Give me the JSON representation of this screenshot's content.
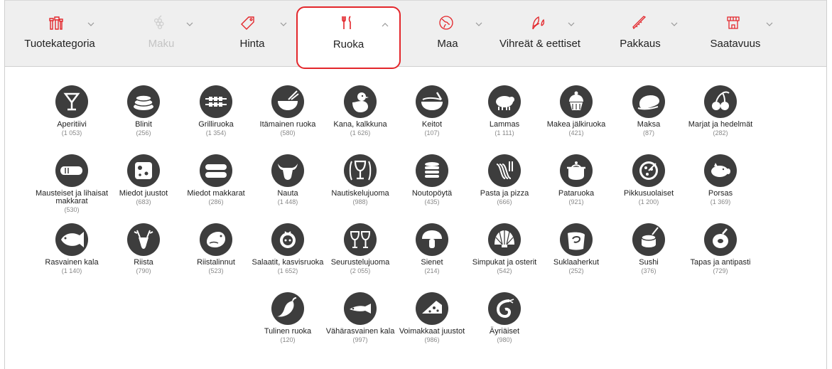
{
  "filter_tabs": [
    {
      "id": "tuotekategoria",
      "label": "Tuotekategoria",
      "icon": "bottles-icon",
      "state": "normal",
      "chevron": "down"
    },
    {
      "id": "maku",
      "label": "Maku",
      "icon": "grapes-icon",
      "state": "disabled",
      "chevron": "down"
    },
    {
      "id": "hinta",
      "label": "Hinta",
      "icon": "price-tag-icon",
      "state": "normal",
      "chevron": "down"
    },
    {
      "id": "ruoka",
      "label": "Ruoka",
      "icon": "fork-knife-icon",
      "state": "active",
      "chevron": "up"
    },
    {
      "id": "maa",
      "label": "Maa",
      "icon": "globe-icon",
      "state": "normal",
      "chevron": "down"
    },
    {
      "id": "vihreat",
      "label": "Vihreät & eettiset",
      "icon": "leaf-icon",
      "state": "normal",
      "chevron": "down"
    },
    {
      "id": "pakkaus",
      "label": "Pakkaus",
      "icon": "package-icon",
      "state": "normal",
      "chevron": "down"
    },
    {
      "id": "saatavuus",
      "label": "Saatavuus",
      "icon": "store-icon",
      "state": "normal",
      "chevron": "down"
    }
  ],
  "colors": {
    "accent": "#e3262b",
    "icon_circle": "#3d3d3d",
    "bar": "#efefef",
    "count": "#888888"
  },
  "food_items": [
    {
      "name": "Aperitiivi",
      "count": "(1 053)",
      "icon": "cocktail-glass-icon"
    },
    {
      "name": "Blinit",
      "count": "(256)",
      "icon": "blini-stack-icon"
    },
    {
      "name": "Grilliruoka",
      "count": "(1 354)",
      "icon": "grill-skewers-icon"
    },
    {
      "name": "Itämainen ruoka",
      "count": "(580)",
      "icon": "asian-bowl-chopsticks-icon"
    },
    {
      "name": "Kana, kalkkuna",
      "count": "(1 626)",
      "icon": "chicken-icon"
    },
    {
      "name": "Keitot",
      "count": "(107)",
      "icon": "soup-bowl-icon"
    },
    {
      "name": "Lammas",
      "count": "(1 111)",
      "icon": "sheep-icon"
    },
    {
      "name": "Makea jälkiruoka",
      "count": "(421)",
      "icon": "cupcake-icon"
    },
    {
      "name": "Maksa",
      "count": "(87)",
      "icon": "liver-icon"
    },
    {
      "name": "Marjat ja hedelmät",
      "count": "(282)",
      "icon": "cherries-icon"
    },
    {
      "name": "Mausteiset ja lihaisat makkarat",
      "count": "(530)",
      "icon": "sausage-icon"
    },
    {
      "name": "Miedot juustot",
      "count": "(683)",
      "icon": "cheese-icon"
    },
    {
      "name": "Miedot makkarat",
      "count": "(286)",
      "icon": "mild-sausages-icon"
    },
    {
      "name": "Nauta",
      "count": "(1 448)",
      "icon": "cow-icon"
    },
    {
      "name": "Nautiskelujuoma",
      "count": "(988)",
      "icon": "wine-glass-icon"
    },
    {
      "name": "Noutopöytä",
      "count": "(435)",
      "icon": "buffet-plates-icon"
    },
    {
      "name": "Pasta ja pizza",
      "count": "(666)",
      "icon": "pasta-fork-icon"
    },
    {
      "name": "Pataruoka",
      "count": "(921)",
      "icon": "pot-icon"
    },
    {
      "name": "Pikkusuolaiset",
      "count": "(1 200)",
      "icon": "pizza-icon"
    },
    {
      "name": "Porsas",
      "count": "(1 369)",
      "icon": "pig-icon"
    },
    {
      "name": "Rasvainen kala",
      "count": "(1 140)",
      "icon": "fatty-fish-icon"
    },
    {
      "name": "Riista",
      "count": "(790)",
      "icon": "deer-icon"
    },
    {
      "name": "Riistalinnut",
      "count": "(523)",
      "icon": "game-bird-icon"
    },
    {
      "name": "Salaatit, kasvisruoka",
      "count": "(1 652)",
      "icon": "salad-tomato-icon"
    },
    {
      "name": "Seurustelujuoma",
      "count": "(2 055)",
      "icon": "two-glasses-icon"
    },
    {
      "name": "Sienet",
      "count": "(214)",
      "icon": "mushroom-icon"
    },
    {
      "name": "Simpukat ja osterit",
      "count": "(542)",
      "icon": "shell-icon"
    },
    {
      "name": "Suklaaherkut",
      "count": "(252)",
      "icon": "chocolate-icon"
    },
    {
      "name": "Sushi",
      "count": "(376)",
      "icon": "sushi-icon"
    },
    {
      "name": "Tapas ja antipasti",
      "count": "(729)",
      "icon": "olive-icon"
    },
    {
      "name": "Tulinen ruoka",
      "count": "(120)",
      "icon": "chili-pepper-icon"
    },
    {
      "name": "Vähärasvainen kala",
      "count": "(997)",
      "icon": "lean-fish-icon"
    },
    {
      "name": "Voimakkaat juustot",
      "count": "(986)",
      "icon": "strong-cheese-icon"
    },
    {
      "name": "Äyriäiset",
      "count": "(980)",
      "icon": "shrimp-icon"
    }
  ]
}
